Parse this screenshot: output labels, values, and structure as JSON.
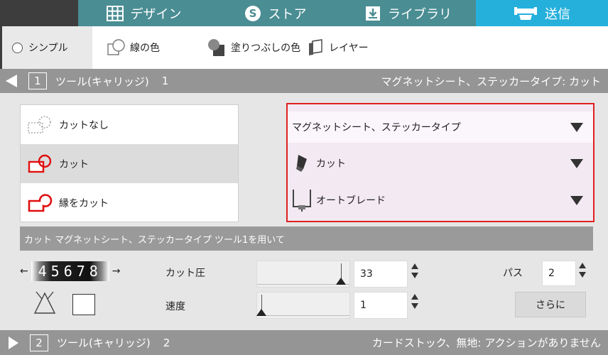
{
  "nav": {
    "tabs": [
      {
        "label": "デザイン",
        "icon": "grid-icon"
      },
      {
        "label": "ストア",
        "icon": "store-s-icon"
      },
      {
        "label": "ライブラリ",
        "icon": "download-box-icon"
      },
      {
        "label": "送信",
        "icon": "cutter-machine-icon",
        "active": true
      }
    ]
  },
  "subbar": {
    "items": [
      {
        "label": "シンプル",
        "icon": "radio-icon",
        "selected": true
      },
      {
        "label": "線の色",
        "icon": "line-color-icon"
      },
      {
        "label": "塗りつぶしの色",
        "icon": "fill-color-icon"
      },
      {
        "label": "レイヤー",
        "icon": "layer-icon"
      }
    ]
  },
  "tool1": {
    "number": "1",
    "title": "ツール(キャリッジ)",
    "index": "1",
    "summary": "マグネットシート、ステッカータイプ: カット"
  },
  "cut_options": [
    {
      "label": "カットなし",
      "icon": "no-cut-icon",
      "selected": false
    },
    {
      "label": "カット",
      "icon": "cut-icon",
      "selected": true
    },
    {
      "label": "縁をカット",
      "icon": "edge-cut-icon",
      "selected": false
    }
  ],
  "material": {
    "type": "マグネットシート、ステッカータイプ",
    "action": "カット",
    "blade": "オートブレード"
  },
  "info_bar": {
    "text": "カット マグネットシート、ステッカータイプ ツール1を用いて"
  },
  "settings": {
    "blade_counter": "45678",
    "pressure_label": "カット圧",
    "pressure_value": "33",
    "pressure_level": 0.95,
    "speed_label": "速度",
    "speed_value": "1",
    "speed_level": 0.0,
    "pass_label": "パス",
    "pass_value": "2",
    "more_label": "さらに"
  },
  "tool2": {
    "number": "2",
    "title": "ツール(キャリッジ)",
    "index": "2",
    "summary": "カードストック、無地: アクションがありません"
  },
  "colors": {
    "tab_bg": "#4a8d93",
    "tab_active": "#25b0dc",
    "highlight_border": "#e02020",
    "cut_red": "#e01010"
  }
}
